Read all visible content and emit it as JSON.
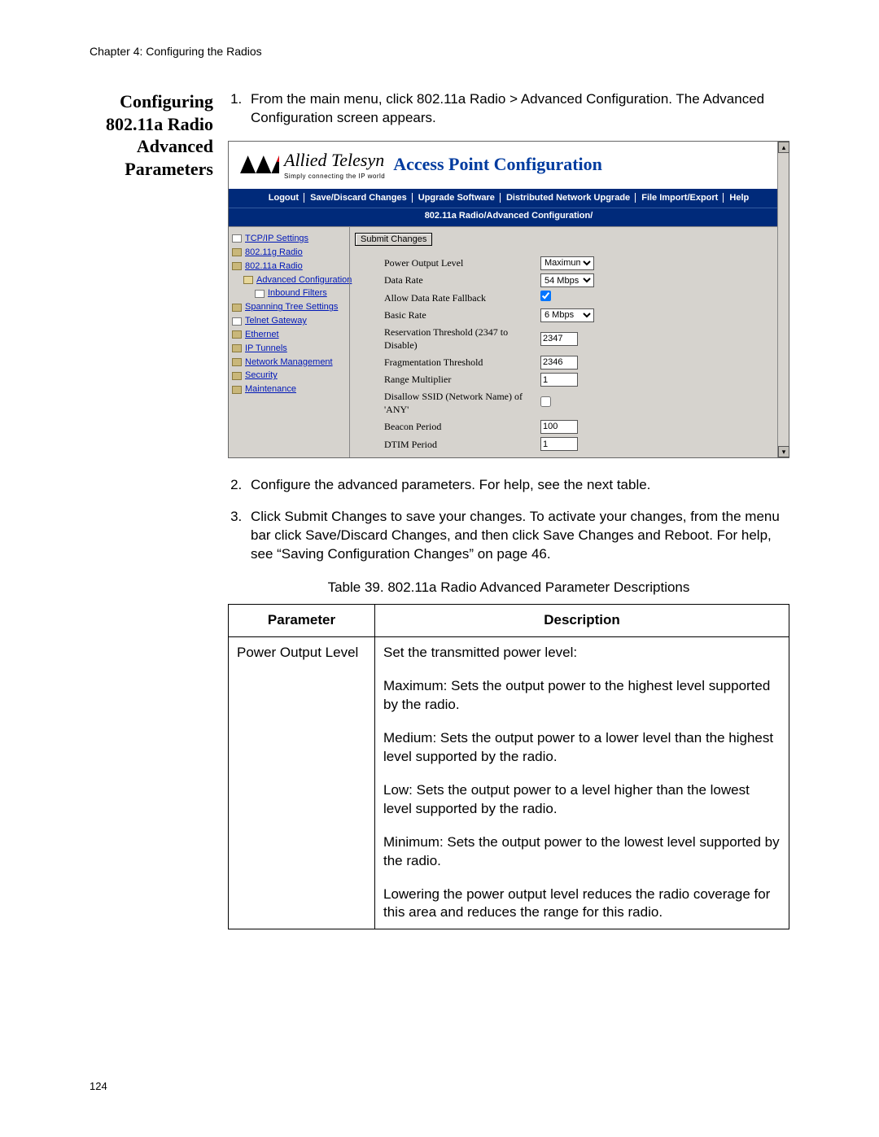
{
  "header": {
    "chapter": "Chapter 4: Configuring the Radios"
  },
  "page_number": "124",
  "side_heading": {
    "l1": "Configuring",
    "l2": "802.11a Radio",
    "l3": "Advanced",
    "l4": "Parameters"
  },
  "steps": {
    "s1": "From the main menu, click 802.11a Radio > Advanced Configuration. The Advanced Configuration screen appears.",
    "s2": "Configure the advanced parameters. For help, see the next table.",
    "s3": "Click Submit Changes to save your changes. To activate your changes, from the menu bar click Save/Discard Changes, and then click Save Changes and Reboot. For help, see “Saving Configuration Changes” on page 46."
  },
  "screenshot": {
    "logo_text": "Allied Telesyn",
    "logo_sub": "Simply connecting the IP world",
    "title": "Access Point Configuration",
    "menu": {
      "m1": "Logout",
      "m2": "Save/Discard Changes",
      "m3": "Upgrade Software",
      "m4": "Distributed Network Upgrade",
      "m5": "File Import/Export",
      "m6": "Help"
    },
    "breadcrumb": "802.11a Radio/Advanced Configuration/",
    "nav": {
      "n0": "TCP/IP Settings",
      "n1": "802.11g Radio",
      "n2": "802.11a Radio",
      "n3": "Advanced Configuration",
      "n4": "Inbound Filters",
      "n5": "Spanning Tree Settings",
      "n6": "Telnet Gateway",
      "n7": "Ethernet",
      "n8": "IP Tunnels",
      "n9": "Network Management",
      "n10": "Security",
      "n11": "Maintenance"
    },
    "submit_label": "Submit Changes",
    "form": {
      "power_output": {
        "label": "Power Output Level",
        "value": "Maximum"
      },
      "data_rate": {
        "label": "Data Rate",
        "value": "54 Mbps"
      },
      "allow_fallback": {
        "label": "Allow Data Rate Fallback",
        "checked": true
      },
      "basic_rate": {
        "label": "Basic Rate",
        "value": "6 Mbps"
      },
      "reservation": {
        "label": "Reservation Threshold (2347 to Disable)",
        "value": "2347"
      },
      "fragmentation": {
        "label": "Fragmentation Threshold",
        "value": "2346"
      },
      "range_mult": {
        "label": "Range Multiplier",
        "value": "1"
      },
      "disallow_ssid": {
        "label": "Disallow SSID (Network Name) of 'ANY'",
        "checked": false
      },
      "beacon": {
        "label": "Beacon Period",
        "value": "100"
      },
      "dtim": {
        "label": "DTIM Period",
        "value": "1"
      }
    }
  },
  "table": {
    "caption": "Table 39. 802.11a Radio Advanced Parameter Descriptions",
    "h1": "Parameter",
    "h2": "Description",
    "row1": {
      "param": "Power Output Level",
      "d1": "Set the transmitted power level:",
      "d2": "Maximum: Sets the output power to the highest level supported by the radio.",
      "d3": "Medium: Sets the output power to a lower level than the highest level supported by the radio.",
      "d4": "Low: Sets the output power to a level higher than the lowest level supported by the radio.",
      "d5": "Minimum: Sets the output power to the lowest level supported by the radio.",
      "d6": "Lowering the power output level reduces the radio coverage for this area and reduces the range for this radio."
    }
  }
}
